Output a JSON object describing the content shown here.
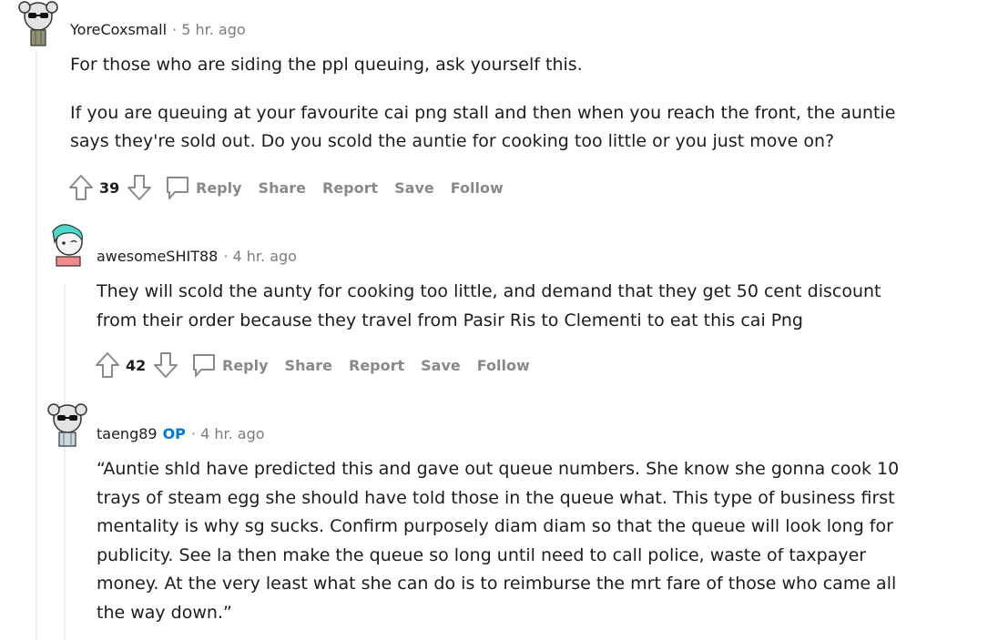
{
  "comments": [
    {
      "username": "YoreCoxsmall",
      "is_op": false,
      "meta": "· 5 hr. ago",
      "paragraphs": [
        [
          "For those who are siding the ppl queuing, ask yourself this."
        ],
        [
          "If you are queuing at your favourite cai png stall and then when you reach the front, the auntie",
          "says they're sold out. Do you scold the auntie for cooking too little or you just move on?"
        ]
      ],
      "score": "39",
      "actions": {
        "reply": "Reply",
        "share": "Share",
        "report": "Report",
        "save": "Save",
        "follow": "Follow"
      }
    },
    {
      "username": "awesomeSHIT88",
      "is_op": false,
      "meta": "· 4 hr. ago",
      "paragraphs": [
        [
          "They will scold the aunty for cooking too little, and demand that they get 50 cent discount",
          "from their order because they travel from Pasir Ris to Clementi to eat this cai Png"
        ]
      ],
      "score": "42",
      "actions": {
        "reply": "Reply",
        "share": "Share",
        "report": "Report",
        "save": "Save",
        "follow": "Follow"
      }
    },
    {
      "username": "taeng89",
      "is_op": true,
      "op_label": "OP",
      "meta": "· 4 hr. ago",
      "paragraphs": [
        [
          "“Auntie shld have predicted this and gave out queue numbers. She know she gonna cook 10",
          "trays of steam egg she should have told those in the queue what. This type of business first",
          "mentality is why sg sucks. Confirm purposely diam diam so that the queue will look long for",
          "publicity. See la then make the queue so long until need to call police, waste of taxpayer",
          "money. At the very least what she can do is to reimburse the mrt fare of those who came all",
          "the way down.”"
        ]
      ]
    }
  ],
  "icons": {
    "upvote": "upvote-arrow-icon",
    "downvote": "downvote-arrow-icon",
    "reply": "speech-bubble-icon"
  },
  "colors": {
    "muted": "#878a8c",
    "op_badge": "#0079d3",
    "thread_line": "#edeff1"
  }
}
